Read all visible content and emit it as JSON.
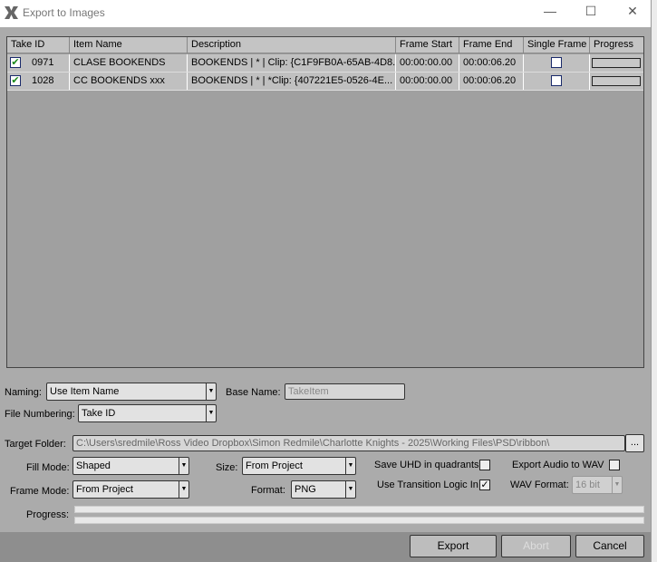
{
  "window": {
    "title": "Export to Images",
    "minimize": "—",
    "maximize": "☐",
    "close": "✕"
  },
  "table": {
    "columns": [
      "Take ID",
      "Item Name",
      "Description",
      "Frame Start",
      "Frame End",
      "Single Frame",
      "Progress"
    ],
    "rows": [
      {
        "checked": true,
        "take_id": "0971",
        "item_name": "CLASE BOOKENDS",
        "description": "BOOKENDS | * | Clip: {C1F9FB0A-65AB-4D8...",
        "frame_start": "00:00:00.00",
        "frame_end": "00:00:06.20",
        "single_frame": false,
        "progress": 0
      },
      {
        "checked": true,
        "take_id": "1028",
        "item_name": "CC BOOKENDS xxx",
        "description": "BOOKENDS | * | *Clip: {407221E5-0526-4E...",
        "frame_start": "00:00:00.00",
        "frame_end": "00:00:06.20",
        "single_frame": false,
        "progress": 0
      }
    ]
  },
  "form": {
    "naming_label": "Naming:",
    "naming_value": "Use Item Name",
    "base_name_label": "Base Name:",
    "base_name_value": "TakeItem",
    "file_numbering_label": "File Numbering:",
    "file_numbering_value": "Take ID",
    "target_folder_label": "Target Folder:",
    "target_folder_value": "C:\\Users\\sredmile\\Ross Video Dropbox\\Simon Redmile\\Charlotte Knights - 2025\\Working Files\\PSD\\ribbon\\",
    "browse_label": "...",
    "fill_mode_label": "Fill Mode:",
    "fill_mode_value": "Shaped",
    "frame_mode_label": "Frame Mode:",
    "frame_mode_value": "From Project",
    "size_label": "Size:",
    "size_value": "From Project",
    "format_label": "Format:",
    "format_value": "PNG",
    "save_uhd_label": "Save UHD in quadrants",
    "save_uhd_checked": false,
    "use_transition_label": "Use Transition Logic In",
    "use_transition_checked": true,
    "export_audio_label": "Export Audio to WAV",
    "export_audio_checked": false,
    "wav_format_label": "WAV Format:",
    "wav_format_value": "16 bit",
    "progress_label": "Progress:",
    "progress_1": 0,
    "progress_2": 0
  },
  "buttons": {
    "export": "Export",
    "abort": "Abort",
    "cancel": "Cancel"
  }
}
